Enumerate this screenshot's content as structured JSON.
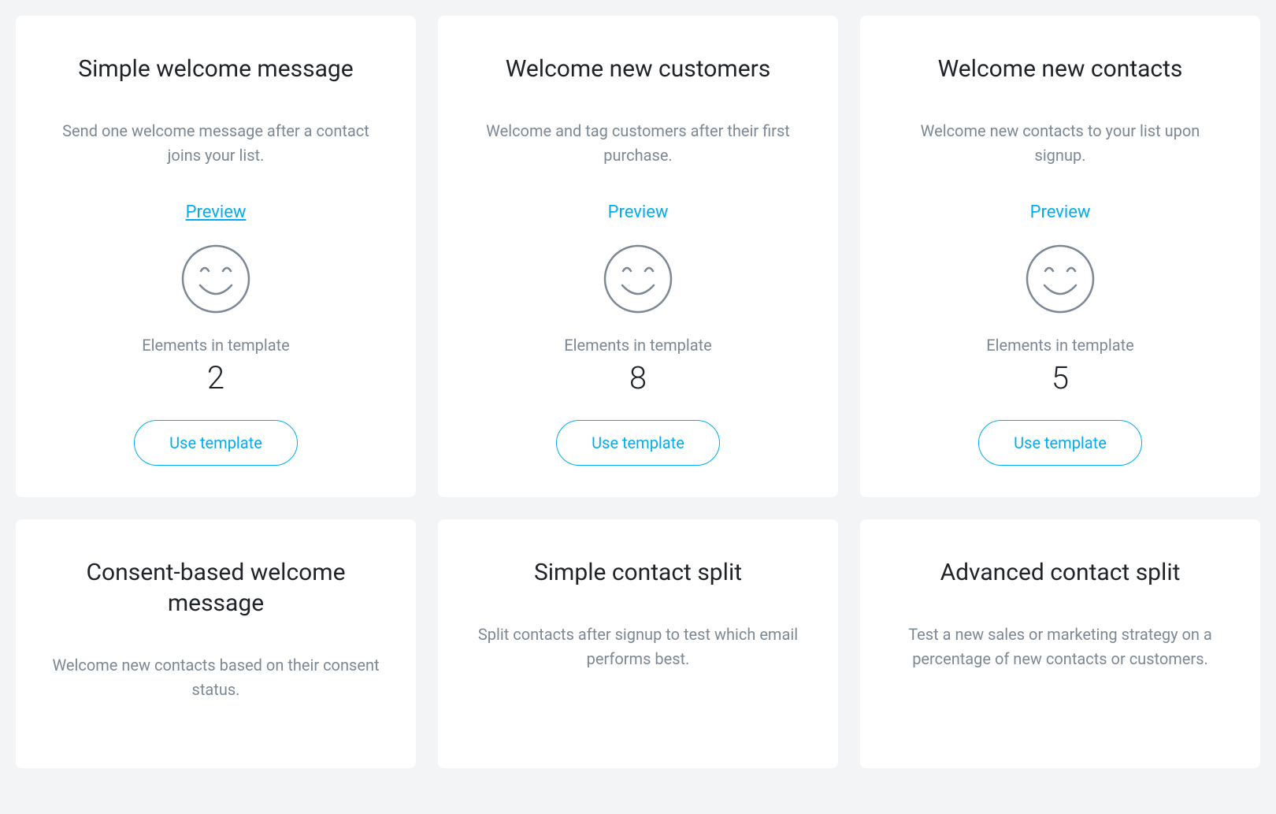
{
  "labels": {
    "preview": "Preview",
    "elements_in_template": "Elements in template",
    "use_template": "Use template"
  },
  "cards": [
    {
      "title": "Simple welcome message",
      "description": "Send one welcome message after a contact joins your list.",
      "count": "2",
      "preview_active": true,
      "show_details": true
    },
    {
      "title": "Welcome new customers",
      "description": "Welcome and tag customers after their first purchase.",
      "count": "8",
      "preview_active": false,
      "show_details": true
    },
    {
      "title": "Welcome new contacts",
      "description": "Welcome new contacts to your list upon signup.",
      "count": "5",
      "preview_active": false,
      "show_details": true
    },
    {
      "title": "Consent-based welcome message",
      "description": "Welcome new contacts based on their consent status.",
      "show_details": false
    },
    {
      "title": "Simple contact split",
      "description": "Split contacts after signup to test which email performs best.",
      "show_details": false
    },
    {
      "title": "Advanced contact split",
      "description": "Test a new sales or marketing strategy on a percentage of new contacts or customers.",
      "show_details": false
    }
  ]
}
